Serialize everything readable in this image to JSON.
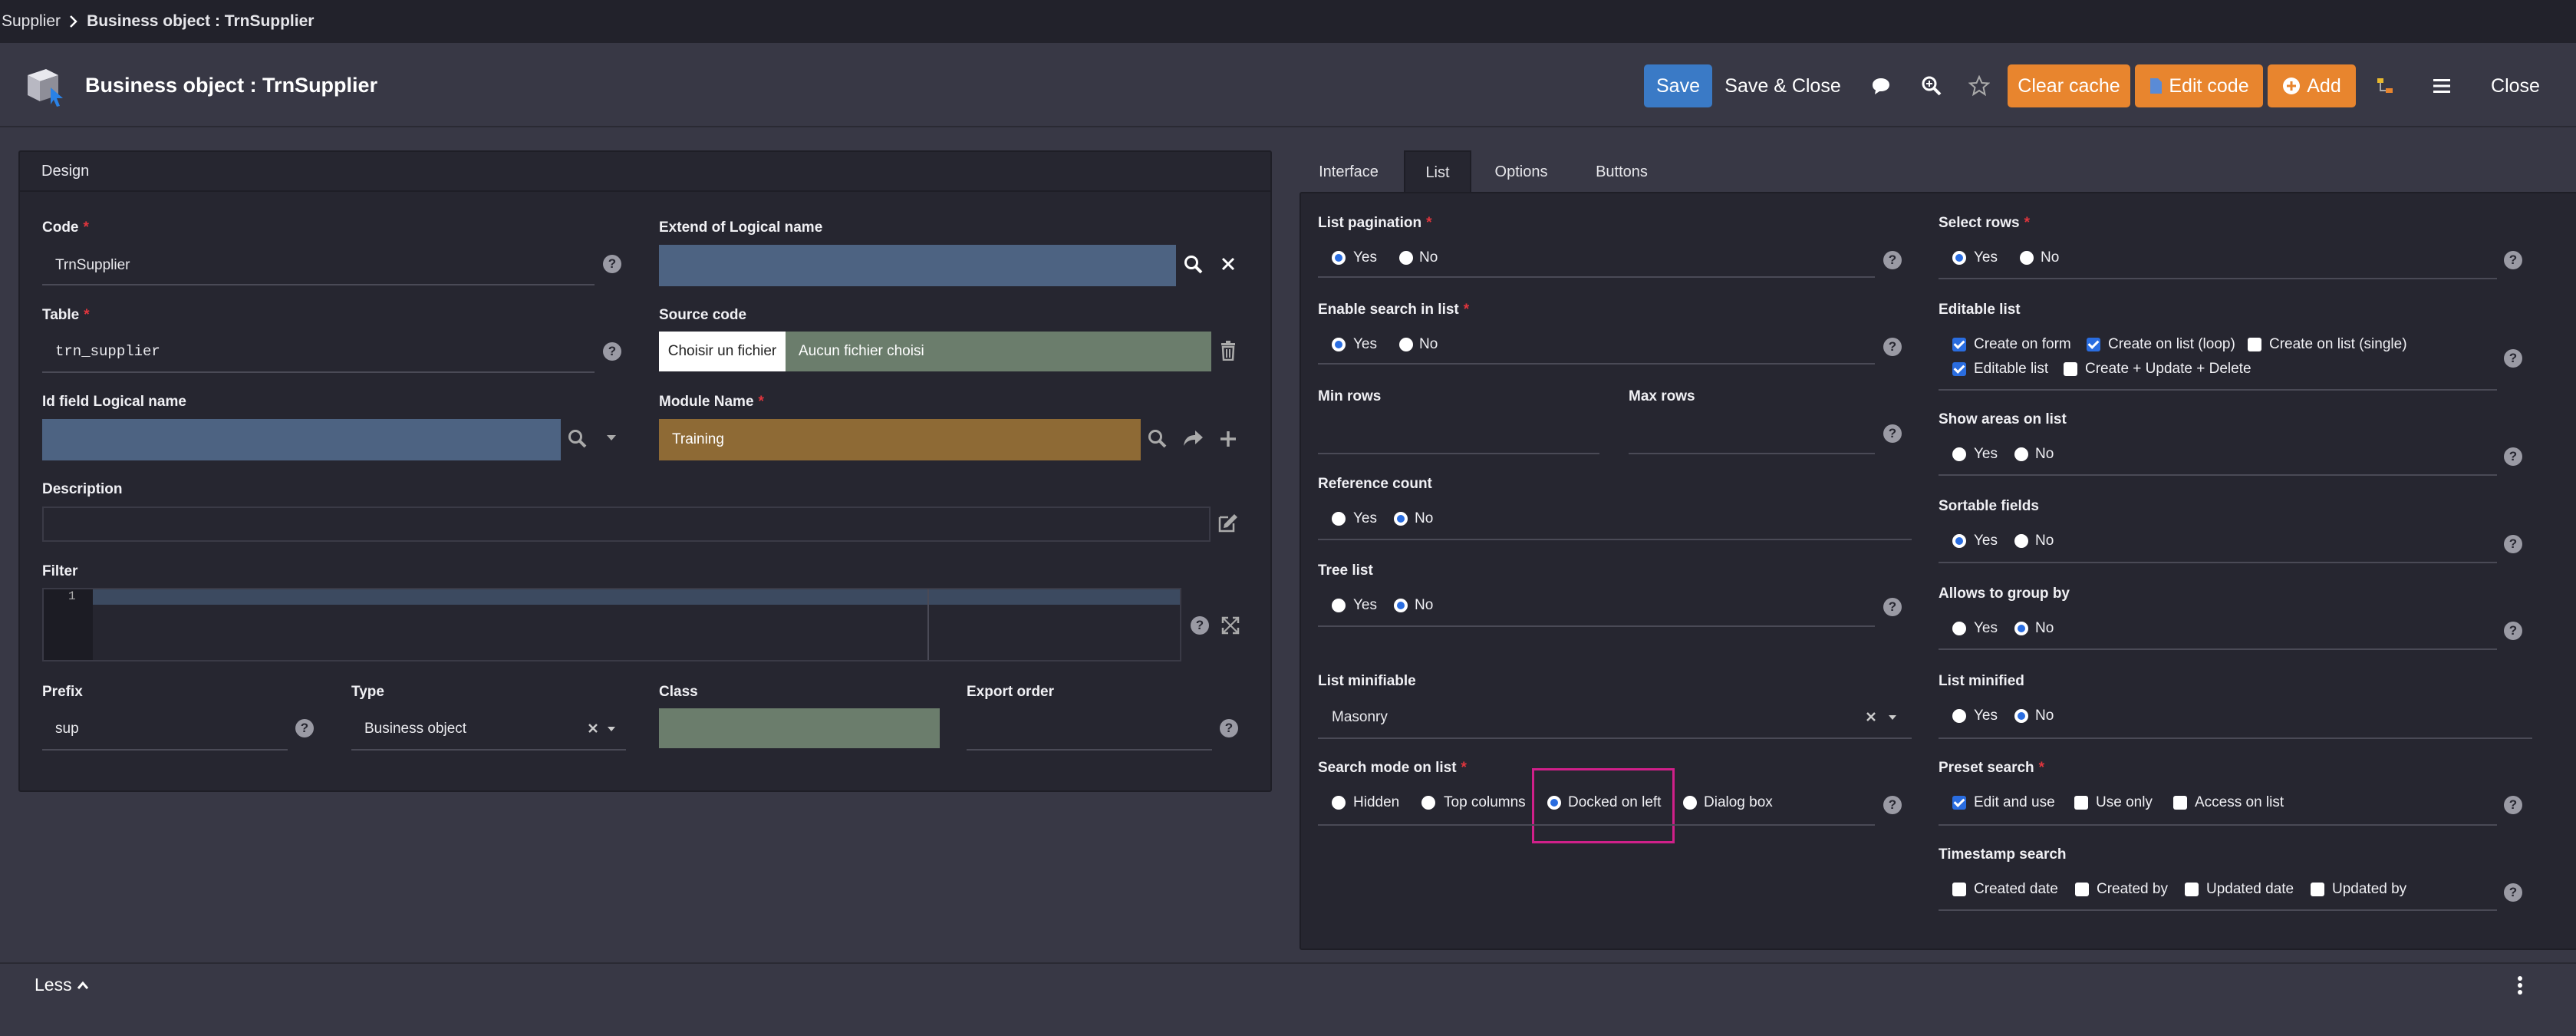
{
  "breadcrumb": {
    "parent": "Supplier",
    "current": "Business object : TrnSupplier"
  },
  "header": {
    "title": "Business object : TrnSupplier",
    "save": "Save",
    "save_close": "Save & Close",
    "clear_cache": "Clear cache",
    "edit_code": "Edit code",
    "add": "Add",
    "close": "Close"
  },
  "design": {
    "panel_title": "Design",
    "code": {
      "label": "Code",
      "value": "TrnSupplier"
    },
    "extend": {
      "label": "Extend of Logical name",
      "value": ""
    },
    "table": {
      "label": "Table",
      "value": "trn_supplier"
    },
    "source_code": {
      "label": "Source code",
      "button": "Choisir un fichier",
      "value": "Aucun fichier choisi"
    },
    "id_field": {
      "label": "Id field Logical name",
      "value": ""
    },
    "module": {
      "label": "Module Name",
      "value": "Training"
    },
    "description": {
      "label": "Description",
      "value": ""
    },
    "filter": {
      "label": "Filter",
      "line_no": "1"
    },
    "prefix": {
      "label": "Prefix",
      "value": "sup"
    },
    "type": {
      "label": "Type",
      "value": "Business object"
    },
    "class": {
      "label": "Class",
      "value": ""
    },
    "export_order": {
      "label": "Export order",
      "value": ""
    }
  },
  "tabs": [
    "Interface",
    "List",
    "Options",
    "Buttons"
  ],
  "list": {
    "pagination": {
      "label": "List pagination",
      "yes": "Yes",
      "no": "No"
    },
    "enable_search": {
      "label": "Enable search in list",
      "yes": "Yes",
      "no": "No"
    },
    "min_rows": {
      "label": "Min rows"
    },
    "max_rows": {
      "label": "Max rows"
    },
    "reference_count": {
      "label": "Reference count",
      "yes": "Yes",
      "no": "No"
    },
    "tree_list": {
      "label": "Tree list",
      "yes": "Yes",
      "no": "No"
    },
    "list_minifiable": {
      "label": "List minifiable",
      "value": "Masonry"
    },
    "search_mode": {
      "label": "Search mode on list",
      "hidden": "Hidden",
      "top_columns": "Top columns",
      "docked_left": "Docked on left",
      "dialog_box": "Dialog box"
    },
    "select_rows": {
      "label": "Select rows",
      "yes": "Yes",
      "no": "No"
    },
    "editable_list": {
      "label": "Editable list",
      "create_form": "Create on form",
      "create_list_loop": "Create on list (loop)",
      "create_list_single": "Create on list (single)",
      "editable": "Editable list",
      "create_update_delete": "Create + Update + Delete"
    },
    "show_areas": {
      "label": "Show areas on list",
      "yes": "Yes",
      "no": "No"
    },
    "sortable": {
      "label": "Sortable fields",
      "yes": "Yes",
      "no": "No"
    },
    "group_by": {
      "label": "Allows to group by",
      "yes": "Yes",
      "no": "No"
    },
    "list_minified": {
      "label": "List minified",
      "yes": "Yes",
      "no": "No"
    },
    "preset_search": {
      "label": "Preset search",
      "edit_use": "Edit and use",
      "use_only": "Use only",
      "access_list": "Access on list"
    },
    "timestamp_search": {
      "label": "Timestamp search",
      "created_date": "Created date",
      "created_by": "Created by",
      "updated_date": "Updated date",
      "updated_by": "Updated by"
    }
  },
  "footer": {
    "less": "Less"
  },
  "colors": {
    "accent_blue": "#3a7ac6",
    "orange": "#e8852e",
    "highlight": "#d0208a",
    "field_blue": "#4d6382",
    "field_green": "#6b7d6c",
    "field_brown": "#8e6a35"
  }
}
